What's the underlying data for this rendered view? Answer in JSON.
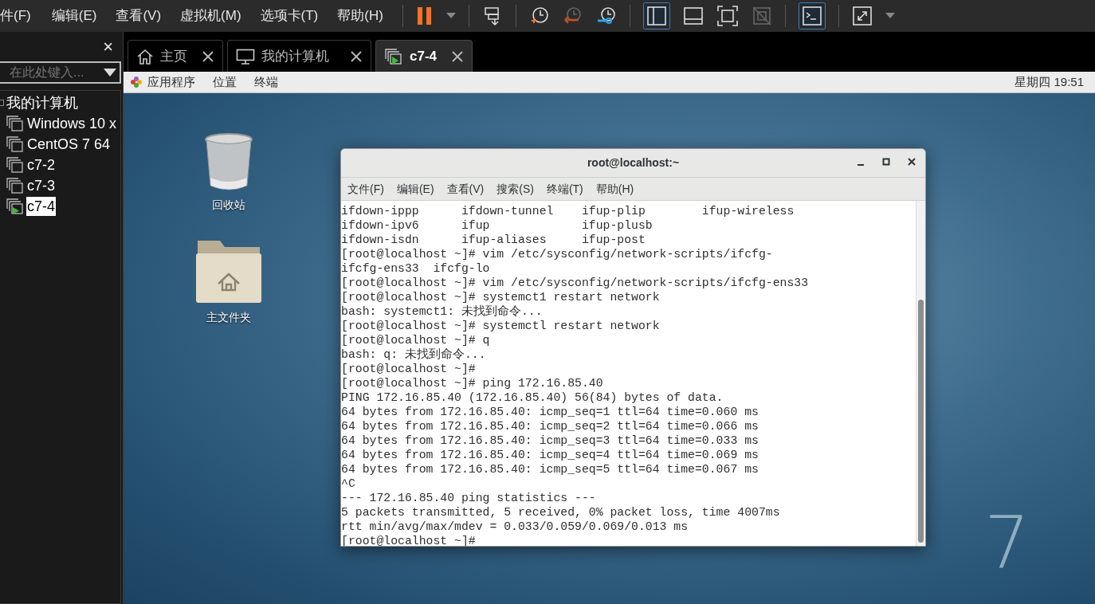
{
  "menu_bar": [
    "件(F)",
    "编辑(E)",
    "查看(V)",
    "虚拟机(M)",
    "选项卡(T)",
    "帮助(H)"
  ],
  "sidebar": {
    "close": "×",
    "search": {
      "placeholder": "在此处键入..."
    },
    "tree": [
      {
        "label": "我的计算机",
        "selected": false,
        "children": [
          {
            "label": "Windows 10 x",
            "selected": false,
            "running": false
          },
          {
            "label": "CentOS 7 64 ",
            "selected": false,
            "running": false
          },
          {
            "label": "c7-2",
            "selected": false,
            "running": false
          },
          {
            "label": "c7-3",
            "selected": false,
            "running": false
          },
          {
            "label": "c7-4",
            "selected": true,
            "running": true
          }
        ]
      }
    ]
  },
  "tabs": [
    {
      "kind": "home",
      "label": "主页",
      "selected": false
    },
    {
      "kind": "computer",
      "label": "我的计算机",
      "selected": false
    },
    {
      "kind": "vm",
      "label": "c7-4",
      "selected": true
    }
  ],
  "guest": {
    "top_bar": {
      "menus": [
        "应用程序",
        "位置",
        "终端"
      ],
      "clock": "星期四 19:51"
    },
    "desktop_icons": [
      {
        "kind": "trash",
        "label": "回收站"
      },
      {
        "kind": "folder",
        "label": "主文件夹"
      }
    ],
    "wallpaper_mark": "7",
    "terminal": {
      "title": "root@localhost:~",
      "menus": [
        "文件(F)",
        "编辑(E)",
        "查看(V)",
        "搜索(S)",
        "终端(T)",
        "帮助(H)"
      ],
      "lines": [
        "ifdown-ippp      ifdown-tunnel    ifup-plip        ifup-wireless",
        "ifdown-ipv6      ifup             ifup-plusb",
        "ifdown-isdn      ifup-aliases     ifup-post",
        "[root@localhost ~]# vim /etc/sysconfig/network-scripts/ifcfg-",
        "ifcfg-ens33  ifcfg-lo",
        "[root@localhost ~]# vim /etc/sysconfig/network-scripts/ifcfg-ens33",
        "[root@localhost ~]# systemct1 restart network",
        "bash: systemct1: 未找到命令...",
        "[root@localhost ~]# systemctl restart network",
        "[root@localhost ~]# q",
        "bash: q: 未找到命令...",
        "[root@localhost ~]#",
        "[root@localhost ~]# ping 172.16.85.40",
        "PING 172.16.85.40 (172.16.85.40) 56(84) bytes of data.",
        "64 bytes from 172.16.85.40: icmp_seq=1 ttl=64 time=0.060 ms",
        "64 bytes from 172.16.85.40: icmp_seq=2 ttl=64 time=0.066 ms",
        "64 bytes from 172.16.85.40: icmp_seq=3 ttl=64 time=0.033 ms",
        "64 bytes from 172.16.85.40: icmp_seq=4 ttl=64 time=0.069 ms",
        "64 bytes from 172.16.85.40: icmp_seq=5 ttl=64 time=0.067 ms",
        "^C",
        "--- 172.16.85.40 ping statistics ---",
        "5 packets transmitted, 5 received, 0% packet loss, time 4007ms",
        "rtt min/avg/max/mdev = 0.033/0.059/0.069/0.013 ms",
        "[root@localhost ~]#"
      ]
    }
  }
}
